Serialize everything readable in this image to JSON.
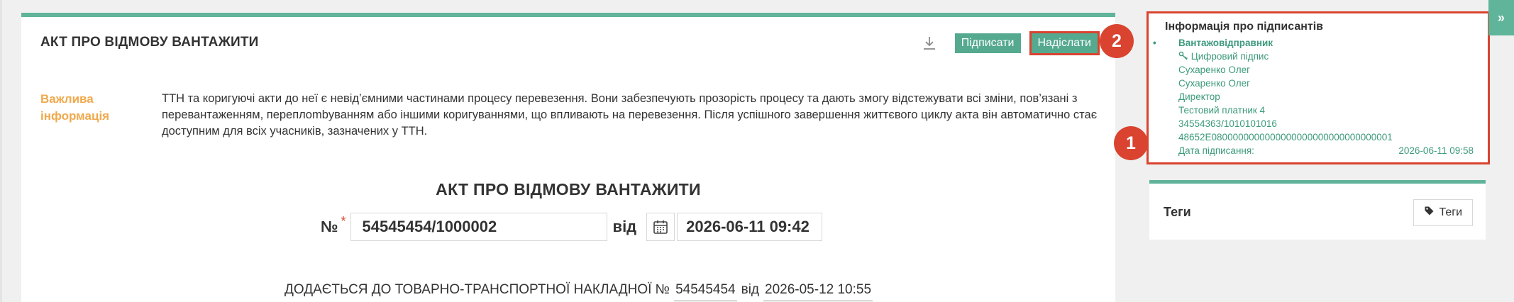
{
  "card": {
    "title": "АКТ ПРО ВІДМОВУ ВАНТАЖИТИ",
    "sign_label": "Підписати",
    "send_label": "Надіслати"
  },
  "info": {
    "label": "Важлива інформація",
    "text": "ТТН та коригуючі акти до неї є невід’ємними частинами процесу перевезення. Вони забезпечують прозорість процесу та дають змогу відстежувати всі зміни, пов’язані з перевантаженням, переплombуванням або іншими коригуваннями, що впливають на перевезення. Після успішного завершення життєвого циклу акта він автоматично стає доступним для всіх учасників, зазначених у ТТН."
  },
  "document": {
    "heading": "АКТ ПРО ВІДМОВУ ВАНТАЖИТИ",
    "number_label": "№",
    "required_mark": "*",
    "number_value": "54545454/1000002",
    "from_label": "від",
    "date_value": "2026-06-11 09:42",
    "attach_text": "ДОДАЄТЬСЯ ДО ТОВАРНО-ТРАНСПОРТНОЇ НАКЛАДНОЇ №",
    "ttn_number": "54545454",
    "attach_from_label": "від",
    "ttn_date": "2026-05-12 10:55"
  },
  "signers": {
    "title": "Інформація про підписантів",
    "role": "Вантажовідправник",
    "signature_type": "Цифровий підпис",
    "name_1": "Сухаренко Олег",
    "name_2": "Сухаренко Олег",
    "position": "Директор",
    "payer": "Тестовий платник 4",
    "code": "34554363/1010101016",
    "serial": "48652E0800000000000000000000000000000001",
    "signed_date_label": "Дата підписання:",
    "signed_date_value": "2026-06-11 09:58"
  },
  "badges": {
    "one": "1",
    "two": "2"
  },
  "tags": {
    "title": "Теги",
    "button_label": "Теги"
  },
  "expand": {
    "label": "»"
  },
  "colors": {
    "accent": "#5fb49a",
    "button": "#55a98f",
    "highlight": "#d9432f",
    "info_label": "#f0a94c",
    "signer_text": "#3c9a7c"
  }
}
